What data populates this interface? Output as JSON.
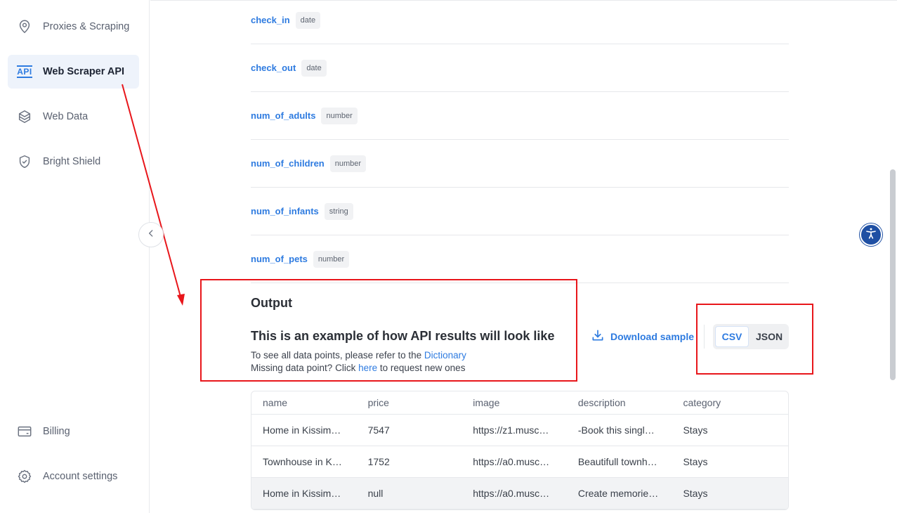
{
  "sidebar": {
    "items": [
      {
        "label": "Proxies & Scraping",
        "icon": "location-pin-icon",
        "active": false
      },
      {
        "label": "Web Scraper API",
        "icon": "api-icon",
        "active": true
      },
      {
        "label": "Web Data",
        "icon": "layers-icon",
        "active": false
      },
      {
        "label": "Bright Shield",
        "icon": "shield-check-icon",
        "active": false
      }
    ],
    "bottom_items": [
      {
        "label": "Billing",
        "icon": "credit-card-icon"
      },
      {
        "label": "Account settings",
        "icon": "gear-icon"
      }
    ],
    "api_icon_text": "API"
  },
  "params": [
    {
      "name": "check_in",
      "type": "date"
    },
    {
      "name": "check_out",
      "type": "date"
    },
    {
      "name": "num_of_adults",
      "type": "number"
    },
    {
      "name": "num_of_children",
      "type": "number"
    },
    {
      "name": "num_of_infants",
      "type": "string"
    },
    {
      "name": "num_of_pets",
      "type": "number"
    }
  ],
  "output": {
    "title": "Output",
    "subtitle": "This is an example of how API results will look like",
    "note1_prefix": "To see all data points, please refer to the ",
    "note1_link": "Dictionary",
    "note2_prefix": "Missing data point? Click ",
    "note2_link": "here",
    "note2_suffix": " to request new ones",
    "download_label": "Download sample",
    "formats": [
      "CSV",
      "JSON"
    ],
    "selected_format": "CSV"
  },
  "table": {
    "columns": [
      "name",
      "price",
      "image",
      "description",
      "category"
    ],
    "rows": [
      [
        "Home in Kissim…",
        "7547",
        "https://z1.musc…",
        "-Book this singl…",
        "Stays"
      ],
      [
        "Townhouse in K…",
        "1752",
        "https://a0.musc…",
        "Beautifull townh…",
        "Stays"
      ],
      [
        "Home in Kissim…",
        "null",
        "https://a0.musc…",
        "Create memorie…",
        "Stays"
      ]
    ],
    "highlighted_row": 2
  },
  "colors": {
    "accent": "#2e7be0",
    "annotation": "#e8161b",
    "accessibility_button": "#1e4fa3"
  }
}
